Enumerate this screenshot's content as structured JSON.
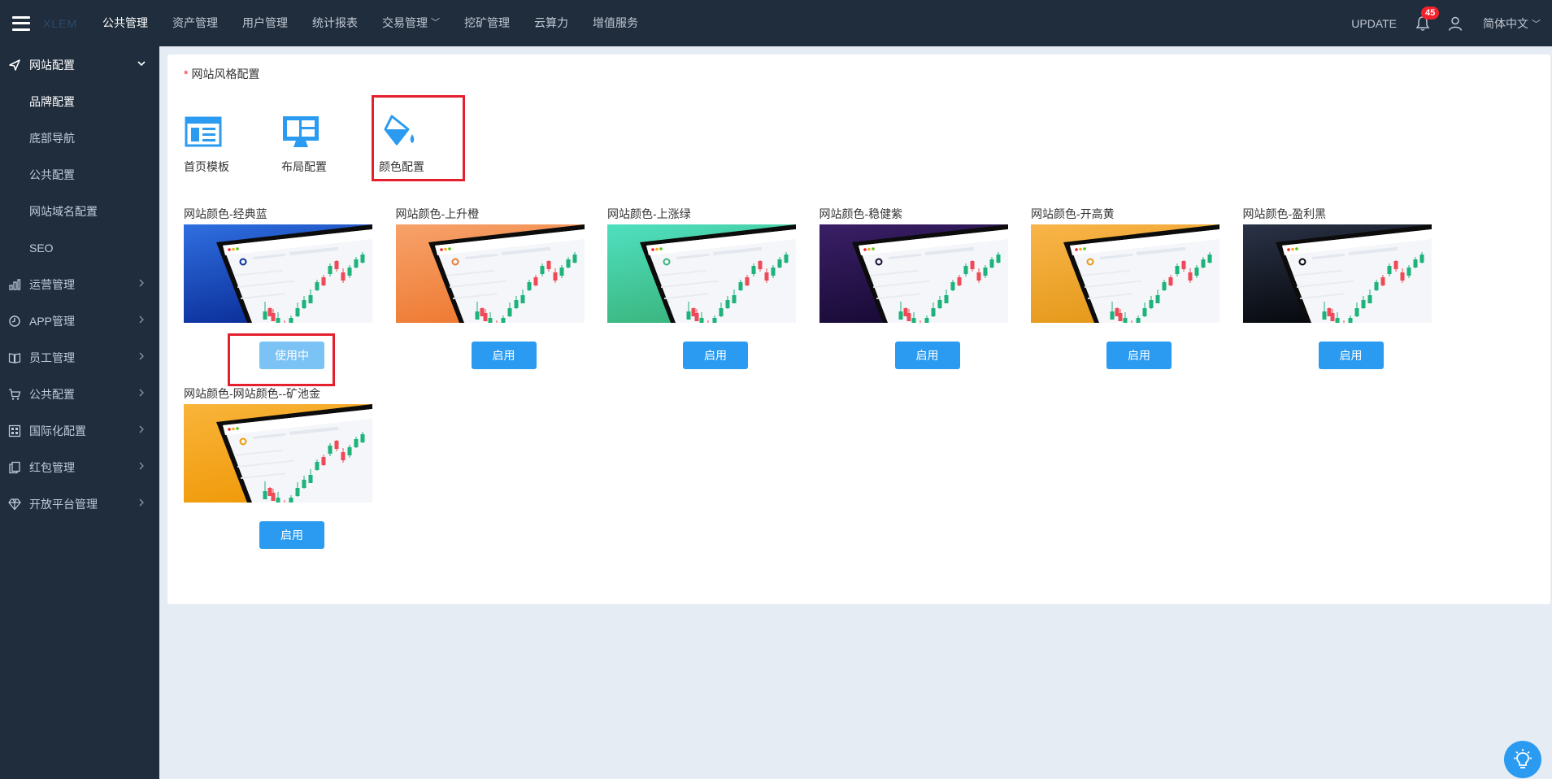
{
  "topbar": {
    "logo": "XLEM",
    "nav": [
      {
        "label": "公共管理",
        "active": true,
        "dropdown": false
      },
      {
        "label": "资产管理",
        "active": false,
        "dropdown": false
      },
      {
        "label": "用户管理",
        "active": false,
        "dropdown": false
      },
      {
        "label": "统计报表",
        "active": false,
        "dropdown": false
      },
      {
        "label": "交易管理",
        "active": false,
        "dropdown": true
      },
      {
        "label": "挖矿管理",
        "active": false,
        "dropdown": false
      },
      {
        "label": "云算力",
        "active": false,
        "dropdown": false
      },
      {
        "label": "增值服务",
        "active": false,
        "dropdown": false
      }
    ],
    "update_label": "UPDATE",
    "notification_count": "45",
    "language": "简体中文"
  },
  "sidebar": {
    "groups": [
      {
        "label": "网站配置",
        "icon": "send-icon",
        "open": true,
        "children": [
          {
            "label": "品牌配置",
            "active": true
          },
          {
            "label": "底部导航",
            "active": false
          },
          {
            "label": "公共配置",
            "active": false
          },
          {
            "label": "网站域名配置",
            "active": false
          },
          {
            "label": "SEO",
            "active": false
          }
        ]
      },
      {
        "label": "运营管理",
        "icon": "bar-chart-icon",
        "open": false
      },
      {
        "label": "APP管理",
        "icon": "clock-icon",
        "open": false
      },
      {
        "label": "员工管理",
        "icon": "book-icon",
        "open": false
      },
      {
        "label": "公共配置",
        "icon": "cart-icon",
        "open": false
      },
      {
        "label": "国际化配置",
        "icon": "grid-icon",
        "open": false
      },
      {
        "label": "红包管理",
        "icon": "copy-icon",
        "open": false
      },
      {
        "label": "开放平台管理",
        "icon": "diamond-icon",
        "open": false
      }
    ]
  },
  "content": {
    "section_title": "网站风格配置",
    "required_mark": "*",
    "tabs": [
      {
        "label": "首页模板",
        "icon": "layout-template-icon"
      },
      {
        "label": "布局配置",
        "icon": "monitor-layout-icon"
      },
      {
        "label": "颜色配置",
        "icon": "paint-bucket-icon",
        "selected": true
      }
    ],
    "themes": [
      {
        "name": "网站颜色-经典蓝",
        "button": "使用中",
        "in_use": true,
        "colors": [
          "#2f6fe0",
          "#0b2f9a"
        ]
      },
      {
        "name": "网站颜色-上升橙",
        "button": "启用",
        "in_use": false,
        "colors": [
          "#f7a26b",
          "#ee7a32"
        ]
      },
      {
        "name": "网站颜色-上涨绿",
        "button": "启用",
        "in_use": false,
        "colors": [
          "#4fe0c0",
          "#3bb57e"
        ]
      },
      {
        "name": "网站颜色-稳健紫",
        "button": "启用",
        "in_use": false,
        "colors": [
          "#3a1f66",
          "#180a36"
        ]
      },
      {
        "name": "网站颜色-开高黄",
        "button": "启用",
        "in_use": false,
        "colors": [
          "#f9b54a",
          "#e5991a"
        ]
      },
      {
        "name": "网站颜色-盈利黑",
        "button": "启用",
        "in_use": false,
        "colors": [
          "#2a3347",
          "#06080d"
        ]
      },
      {
        "name": "网站颜色-网站颜色--矿池金",
        "button": "启用",
        "in_use": false,
        "colors": [
          "#f9b43a",
          "#f09a0a"
        ]
      }
    ]
  },
  "colors": {
    "topbar_bg": "#1f2d3d",
    "primary": "#2a9bf0",
    "highlight": "#e5202e"
  }
}
